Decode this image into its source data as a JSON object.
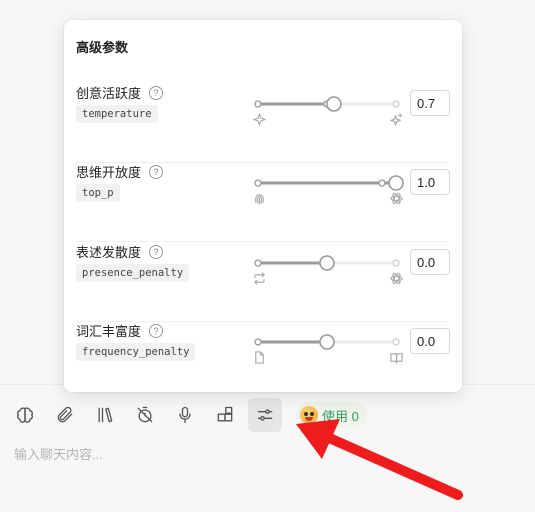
{
  "popover": {
    "title": "高级参数",
    "params": [
      {
        "label": "创意活跃度",
        "key": "temperature",
        "value": "0.7",
        "fraction": 0.55,
        "left_icon": "sparkle-icon",
        "right_icon": "sparkles-icon"
      },
      {
        "label": "思维开放度",
        "key": "top_p",
        "value": "1.0",
        "fraction": 1.0,
        "left_icon": "fingerprint-icon",
        "right_icon": "atom-icon"
      },
      {
        "label": "表述发散度",
        "key": "presence_penalty",
        "value": "0.0",
        "fraction": 0.5,
        "left_icon": "repeat-icon",
        "right_icon": "atom-icon"
      },
      {
        "label": "词汇丰富度",
        "key": "frequency_penalty",
        "value": "0.0",
        "fraction": 0.5,
        "left_icon": "file-icon",
        "right_icon": "book-icon"
      }
    ]
  },
  "toolbar": {
    "buttons": [
      "brain-icon",
      "paperclip-icon",
      "library-icon",
      "timer-off-icon",
      "microphone-icon",
      "plugin-icon",
      "sliders-icon"
    ],
    "usage_label": "使用 0"
  },
  "chat": {
    "placeholder": "输入聊天内容..."
  },
  "colors": {
    "accent_green": "#2e9f5b",
    "arrow_red": "#ee1c1c"
  }
}
